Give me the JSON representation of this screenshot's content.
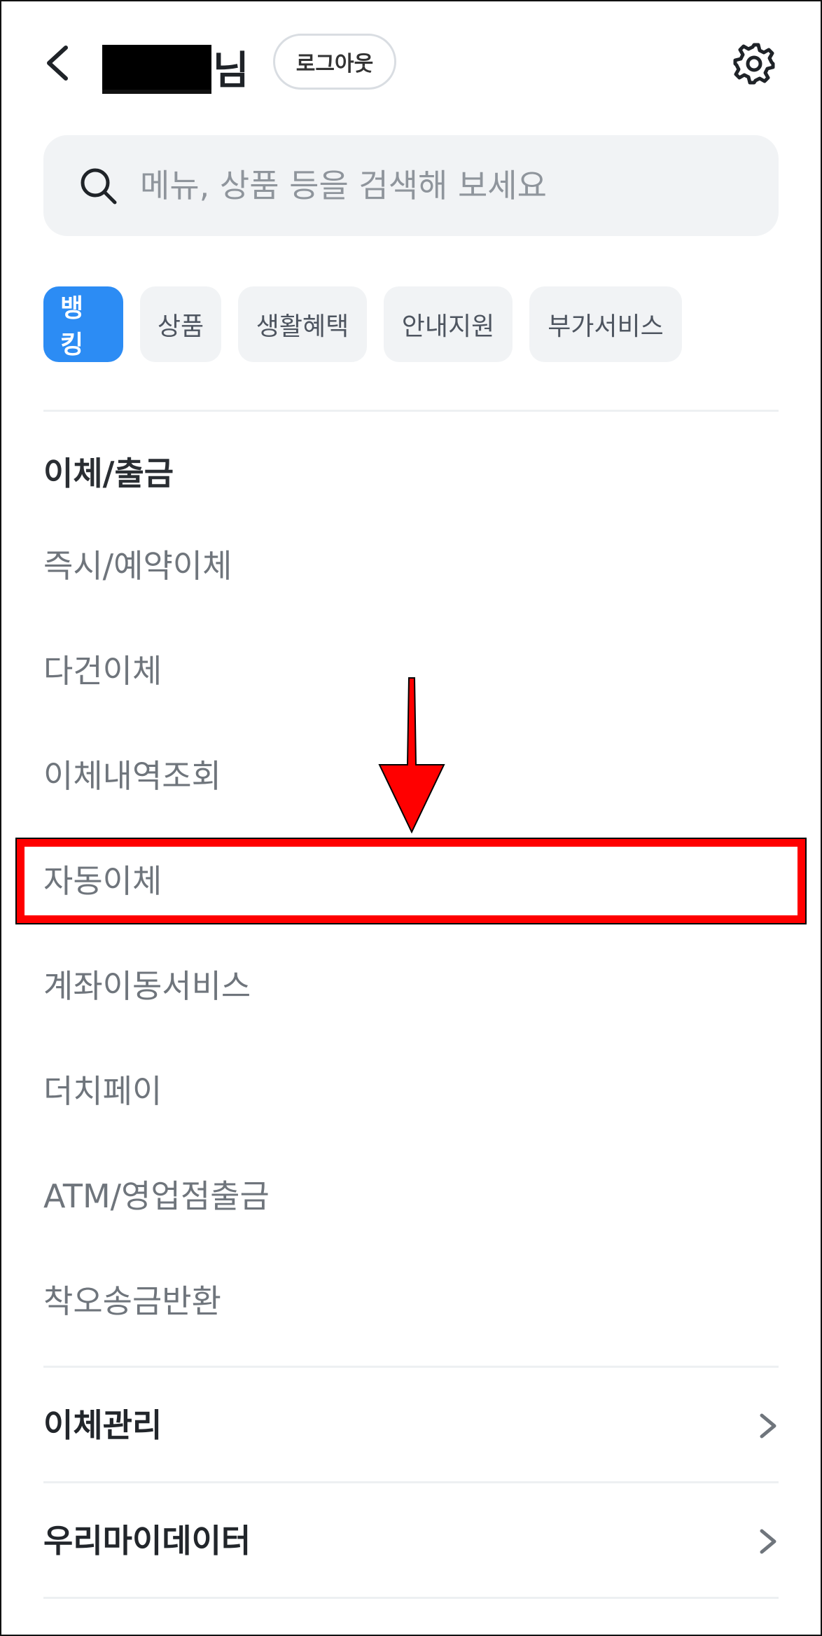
{
  "header": {
    "name_suffix": "님",
    "logout_label": "로그아웃"
  },
  "search": {
    "placeholder": "메뉴, 상품 등을 검색해 보세요"
  },
  "tabs": [
    {
      "label": "뱅킹",
      "active": true
    },
    {
      "label": "상품",
      "active": false
    },
    {
      "label": "생활혜택",
      "active": false
    },
    {
      "label": "안내지원",
      "active": false
    },
    {
      "label": "부가서비스",
      "active": false
    }
  ],
  "section": {
    "title": "이체/출금",
    "items": [
      {
        "label": "즉시/예약이체"
      },
      {
        "label": "다건이체"
      },
      {
        "label": "이체내역조회"
      },
      {
        "label": "자동이체"
      },
      {
        "label": "계좌이동서비스"
      },
      {
        "label": "더치페이"
      },
      {
        "label": "ATM/영업점출금"
      },
      {
        "label": "착오송금반환"
      }
    ]
  },
  "groups": [
    {
      "label": "이체관리"
    },
    {
      "label": "우리마이데이터"
    }
  ],
  "colors": {
    "accent": "#2c8cf4",
    "annotation": "#ff0000"
  },
  "icons": [
    "back-arrow-icon",
    "gear-icon",
    "search-icon",
    "chevron-right-icon",
    "down-arrow-icon"
  ]
}
